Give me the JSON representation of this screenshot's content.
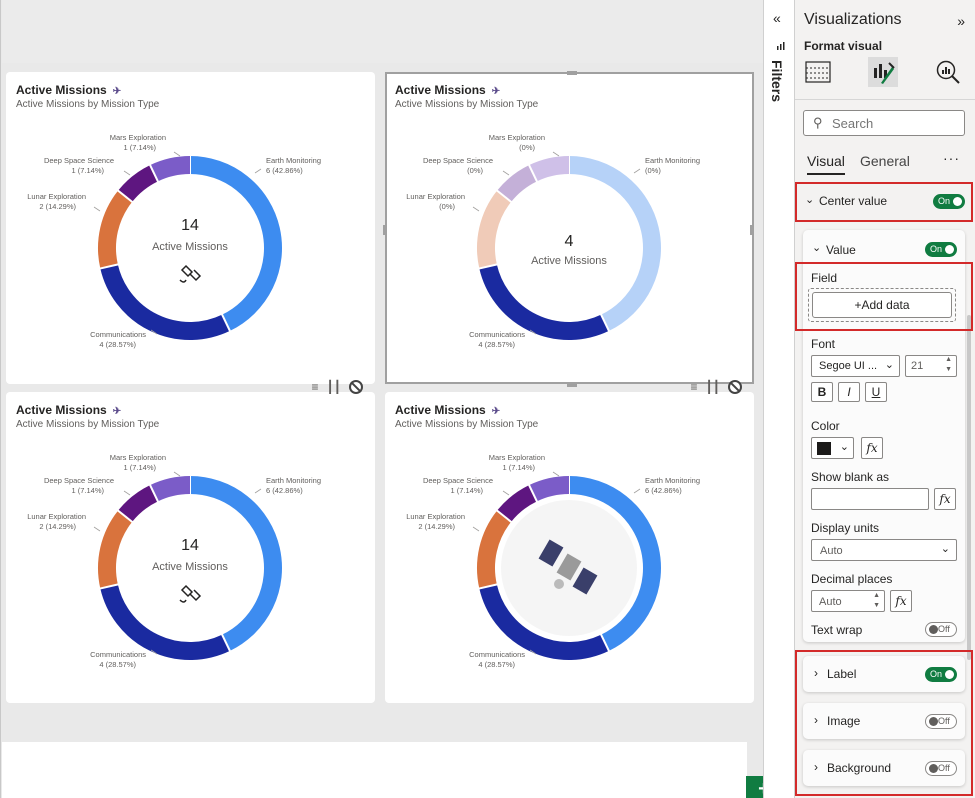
{
  "canvas": {
    "add_page_label": "+"
  },
  "cards": [
    {
      "title": "Active Missions",
      "subtitle": "Active Missions by Mission Type",
      "center_number": "14",
      "center_caption": "Active Missions",
      "center_icon": "satellite-outline-icon",
      "faded": false,
      "labels": [
        {
          "name": "Earth Monitoring",
          "value": "6 (42.86%)"
        },
        {
          "name": "Communications",
          "value": "4 (28.57%)"
        },
        {
          "name": "Lunar Exploration",
          "value": "2 (14.29%)"
        },
        {
          "name": "Deep Space Science",
          "value": "1 (7.14%)"
        },
        {
          "name": "Mars Exploration",
          "value": "1 (7.14%)"
        }
      ]
    },
    {
      "title": "Active Missions",
      "subtitle": "Active Missions by Mission Type",
      "center_number": "4",
      "center_caption": "Active Missions",
      "center_icon": "",
      "faded": true,
      "labels": [
        {
          "name": "Earth Monitoring",
          "value": "(0%)"
        },
        {
          "name": "Communications",
          "value": "4 (28.57%)"
        },
        {
          "name": "Lunar Exploration",
          "value": "(0%)"
        },
        {
          "name": "Deep Space Science",
          "value": "(0%)"
        },
        {
          "name": "Mars Exploration",
          "value": "(0%)"
        }
      ]
    },
    {
      "title": "Active Missions",
      "subtitle": "Active Missions by Mission Type",
      "center_number": "14",
      "center_caption": "Active Missions",
      "center_icon": "satellite-outline-icon",
      "faded": false,
      "labels": [
        {
          "name": "Earth Monitoring",
          "value": "6 (42.86%)"
        },
        {
          "name": "Communications",
          "value": "4 (28.57%)"
        },
        {
          "name": "Lunar Exploration",
          "value": "2 (14.29%)"
        },
        {
          "name": "Deep Space Science",
          "value": "1 (7.14%)"
        },
        {
          "name": "Mars Exploration",
          "value": "1 (7.14%)"
        }
      ]
    },
    {
      "title": "Active Missions",
      "subtitle": "Active Missions by Mission Type",
      "center_number": "",
      "center_caption": "",
      "center_icon": "satellite-image-icon",
      "faded": false,
      "labels": [
        {
          "name": "Earth Monitoring",
          "value": "6 (42.86%)"
        },
        {
          "name": "Communications",
          "value": "4 (28.57%)"
        },
        {
          "name": "Lunar Exploration",
          "value": "2 (14.29%)"
        },
        {
          "name": "Deep Space Science",
          "value": "1 (7.14%)"
        },
        {
          "name": "Mars Exploration",
          "value": "1 (7.14%)"
        }
      ]
    }
  ],
  "chart_data": [
    {
      "type": "pie",
      "variant": "donut",
      "categories": [
        "Earth Monitoring",
        "Communications",
        "Lunar Exploration",
        "Deep Space Science",
        "Mars Exploration"
      ],
      "values": [
        6,
        4,
        2,
        1,
        1
      ],
      "percent_labels": [
        "42.86%",
        "28.57%",
        "14.29%",
        "7.14%",
        "7.14%"
      ],
      "colors": [
        "#3d8cf0",
        "#1a2aa0",
        "#d9733d",
        "#5e1680",
        "#7b5cc8"
      ],
      "center_value": 14,
      "center_label": "Active Missions",
      "title": "Active Missions",
      "subtitle": "Active Missions by Mission Type"
    },
    {
      "type": "pie",
      "variant": "donut",
      "categories": [
        "Earth Monitoring",
        "Communications",
        "Lunar Exploration",
        "Deep Space Science",
        "Mars Exploration"
      ],
      "values": [
        6,
        4,
        2,
        1,
        1
      ],
      "highlighted": [
        "Communications"
      ],
      "colors": [
        "#3d8cf0",
        "#1a2aa0",
        "#d9733d",
        "#5e1680",
        "#7b5cc8"
      ],
      "center_value": 4,
      "center_label": "Active Missions",
      "title": "Active Missions",
      "subtitle": "Active Missions by Mission Type"
    },
    {
      "type": "pie",
      "variant": "donut",
      "categories": [
        "Earth Monitoring",
        "Communications",
        "Lunar Exploration",
        "Deep Space Science",
        "Mars Exploration"
      ],
      "values": [
        6,
        4,
        2,
        1,
        1
      ],
      "percent_labels": [
        "42.86%",
        "28.57%",
        "14.29%",
        "7.14%",
        "7.14%"
      ],
      "colors": [
        "#3d8cf0",
        "#1a2aa0",
        "#d9733d",
        "#5e1680",
        "#7b5cc8"
      ],
      "center_value": 14,
      "center_label": "Active Missions",
      "title": "Active Missions",
      "subtitle": "Active Missions by Mission Type"
    },
    {
      "type": "pie",
      "variant": "donut",
      "categories": [
        "Earth Monitoring",
        "Communications",
        "Lunar Exploration",
        "Deep Space Science",
        "Mars Exploration"
      ],
      "values": [
        6,
        4,
        2,
        1,
        1
      ],
      "percent_labels": [
        "42.86%",
        "28.57%",
        "14.29%",
        "7.14%",
        "7.14%"
      ],
      "colors": [
        "#3d8cf0",
        "#1a2aa0",
        "#d9733d",
        "#5e1680",
        "#7b5cc8"
      ],
      "title": "Active Missions",
      "subtitle": "Active Missions by Mission Type"
    }
  ],
  "filters": {
    "label": "Filters",
    "collapse_glyph": "«"
  },
  "viz_pane": {
    "title": "Visualizations",
    "expand_glyph": "»",
    "format_visual_label": "Format visual",
    "search_placeholder": "Search",
    "tabs": {
      "visual": "Visual",
      "general": "General",
      "more": "···"
    },
    "center_value": {
      "label": "Center value",
      "toggle": "On"
    },
    "value": {
      "label": "Value",
      "toggle": "On"
    },
    "field": {
      "label": "Field",
      "add_data": "+Add data"
    },
    "font": {
      "label": "Font",
      "family": "Segoe UI ...",
      "size": "21"
    },
    "style_buttons": {
      "bold": "B",
      "italic": "I",
      "underline": "U"
    },
    "color": {
      "label": "Color",
      "swatch": "#1b1a19"
    },
    "show_blank_as": {
      "label": "Show blank as",
      "value": ""
    },
    "display_units": {
      "label": "Display units",
      "value": "Auto"
    },
    "decimal_places": {
      "label": "Decimal places",
      "value": "Auto"
    },
    "text_wrap": {
      "label": "Text wrap",
      "toggle": "Off"
    },
    "fx_label": "fx",
    "sections": [
      {
        "label": "Label",
        "toggle": "On"
      },
      {
        "label": "Image",
        "toggle": "Off"
      },
      {
        "label": "Background",
        "toggle": "Off"
      }
    ]
  }
}
